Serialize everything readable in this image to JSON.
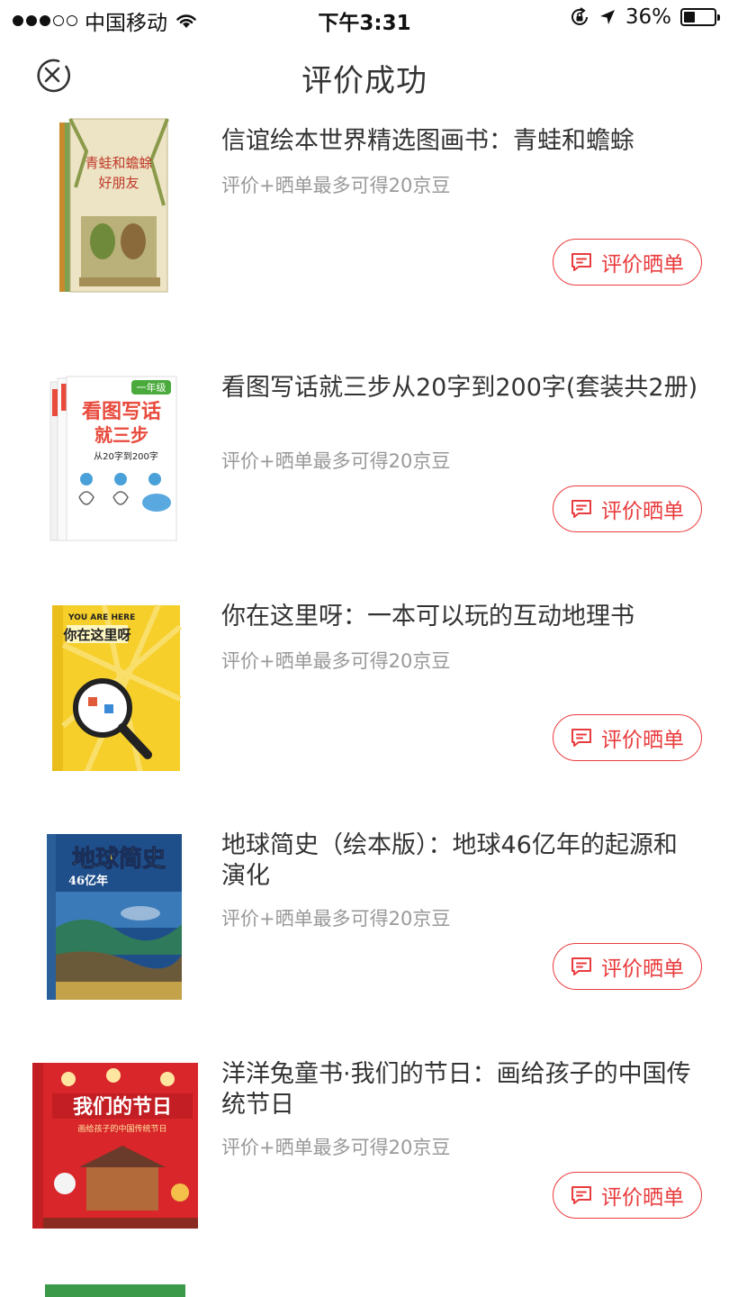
{
  "status_bar": {
    "signal_filled": 3,
    "signal_total": 5,
    "carrier": "中国移动",
    "time": "下午3:31",
    "battery_text": "36%",
    "battery_level": 0.36,
    "icons": [
      "wifi-icon",
      "orientation-lock-icon",
      "location-arrow-icon",
      "battery-icon"
    ]
  },
  "header": {
    "title": "评价成功",
    "close_icon": "close-circle-icon"
  },
  "products": [
    {
      "title": "信谊绘本世界精选图画书：青蛙和蟾蜍",
      "subtitle": "评价+晒单最多可得20京豆",
      "button_label": "评价晒单",
      "cover": {
        "text": "青蛙和蟾蜍",
        "text2": "好朋友",
        "bg": "#e8dfc0",
        "accent": "#8a9a4a"
      }
    },
    {
      "title": "看图写话就三步从20字到200字(套装共2册)",
      "subtitle": "评价+晒单最多可得20京豆",
      "button_label": "评价晒单",
      "cover": {
        "text": "看图写话",
        "text2": "就三步",
        "text3": "从20字到200字",
        "badge": "一年级",
        "bg": "#ffffff",
        "accent": "#e84a3c"
      }
    },
    {
      "title": "你在这里呀：一本可以玩的互动地理书",
      "subtitle": "评价+晒单最多可得20京豆",
      "button_label": "评价晒单",
      "cover": {
        "text": "你在这里呀",
        "text2": "YOU ARE HERE",
        "bg": "#f6cf2a",
        "accent": "#222222"
      }
    },
    {
      "title": "地球简史（绘本版）：地球46亿年的起源和演化",
      "subtitle": "评价+晒单最多可得20京豆",
      "button_label": "评价晒单",
      "cover": {
        "text": "地球简史",
        "text2": "46亿年",
        "bg": "#1f4f8a",
        "accent": "#f4d23a"
      }
    },
    {
      "title": "洋洋兔童书·我们的节日：画给孩子的中国传统节日",
      "subtitle": "评价+晒单最多可得20京豆",
      "button_label": "评价晒单",
      "cover": {
        "text": "我们的节日",
        "text2": "画给孩子的中国传统节日",
        "bg": "#d8262b",
        "accent": "#ffe6a0"
      }
    }
  ],
  "colors": {
    "accent_red": "#e93b3d",
    "text_primary": "#333333",
    "text_secondary": "#999999"
  }
}
